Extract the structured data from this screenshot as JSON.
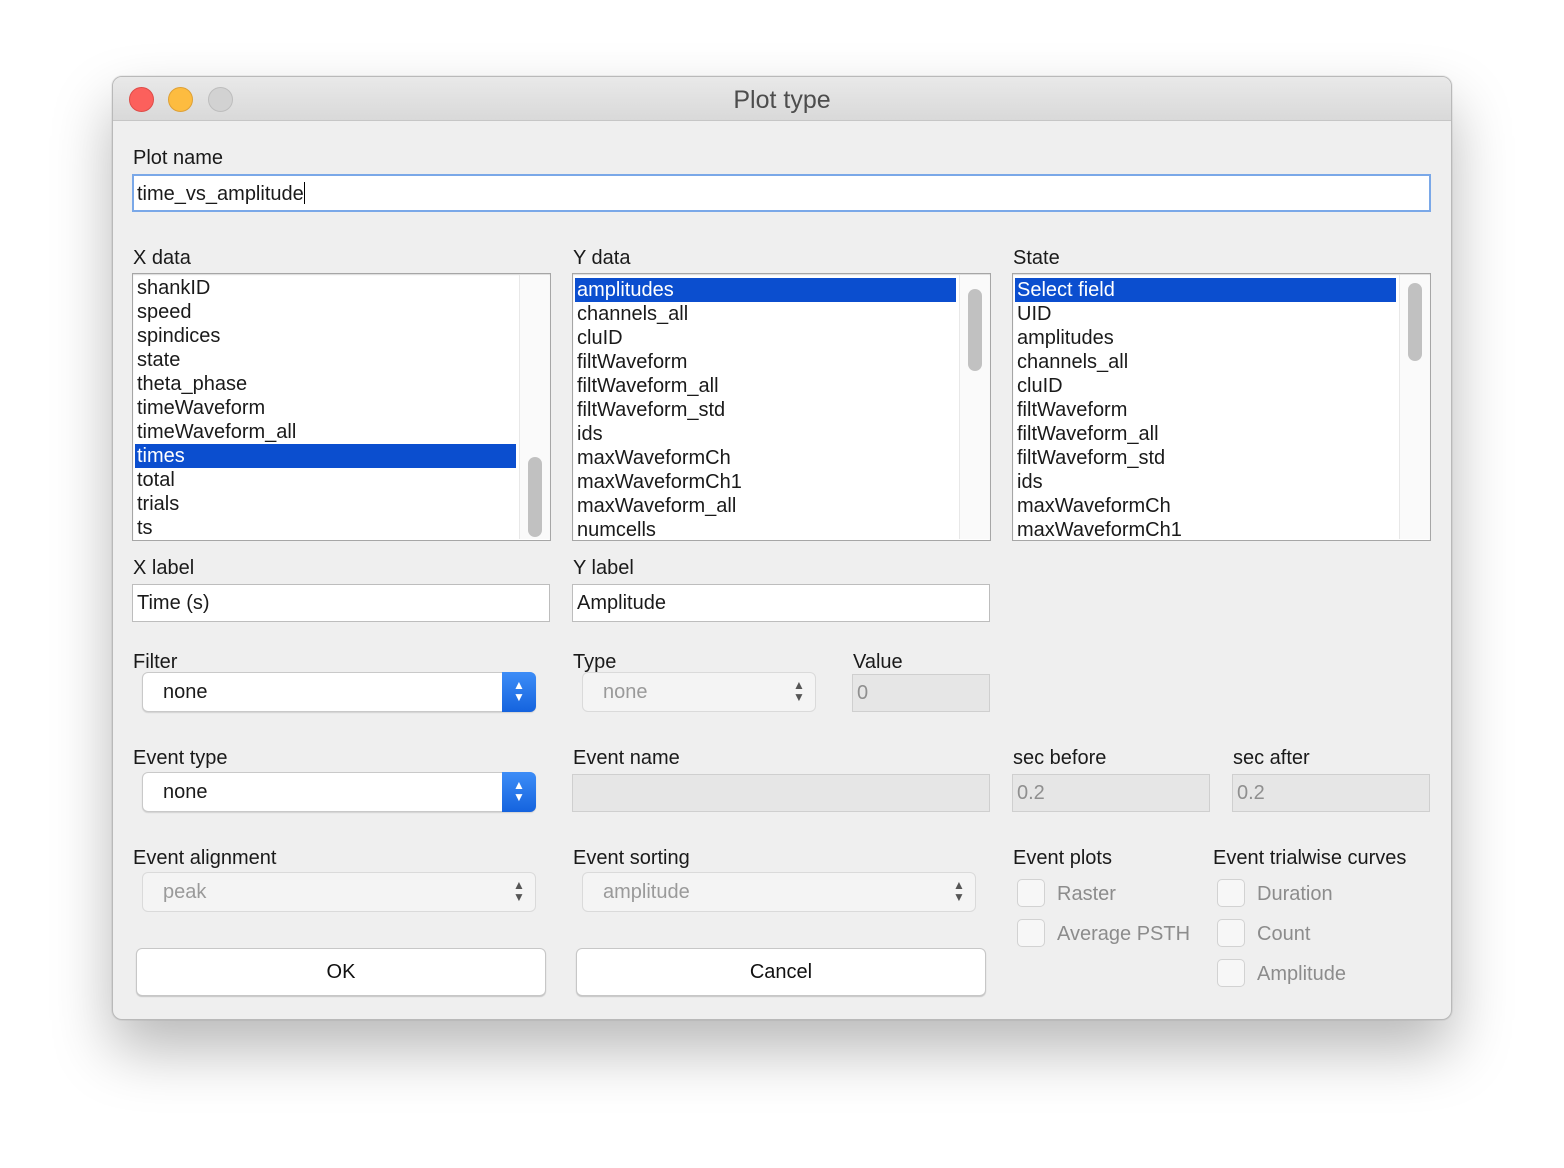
{
  "window": {
    "title": "Plot type"
  },
  "plot_name": {
    "label": "Plot name",
    "value": "time_vs_amplitude"
  },
  "x_data": {
    "label": "X data",
    "items": [
      "shankID",
      "speed",
      "spindices",
      "state",
      "theta_phase",
      "timeWaveform",
      "timeWaveform_all",
      "times",
      "total",
      "trials",
      "ts"
    ],
    "selected": "times"
  },
  "y_data": {
    "label": "Y data",
    "items": [
      "amplitudes",
      "channels_all",
      "cluID",
      "filtWaveform",
      "filtWaveform_all",
      "filtWaveform_std",
      "ids",
      "maxWaveformCh",
      "maxWaveformCh1",
      "maxWaveform_all",
      "numcells"
    ],
    "selected": "amplitudes"
  },
  "state": {
    "label": "State",
    "items": [
      "Select field",
      "UID",
      "amplitudes",
      "channels_all",
      "cluID",
      "filtWaveform",
      "filtWaveform_all",
      "filtWaveform_std",
      "ids",
      "maxWaveformCh",
      "maxWaveformCh1"
    ],
    "selected": "Select field"
  },
  "x_label": {
    "label": "X label",
    "value": "Time (s)"
  },
  "y_label": {
    "label": "Y label",
    "value": "Amplitude"
  },
  "filter": {
    "label": "Filter",
    "value": "none"
  },
  "type": {
    "label": "Type",
    "value": "none"
  },
  "value": {
    "label": "Value",
    "value": "0"
  },
  "event_type": {
    "label": "Event type",
    "value": "none"
  },
  "event_name": {
    "label": "Event name",
    "value": ""
  },
  "sec_before": {
    "label": "sec before",
    "value": "0.2"
  },
  "sec_after": {
    "label": "sec after",
    "value": "0.2"
  },
  "event_alignment": {
    "label": "Event alignment",
    "value": "peak"
  },
  "event_sorting": {
    "label": "Event sorting",
    "value": "amplitude"
  },
  "event_plots": {
    "label": "Event plots",
    "options": [
      "Raster",
      "Average PSTH"
    ]
  },
  "event_trialwise": {
    "label": "Event trialwise curves",
    "options": [
      "Duration",
      "Count",
      "Amplitude"
    ]
  },
  "buttons": {
    "ok": "OK",
    "cancel": "Cancel"
  },
  "colors": {
    "selection": "#0b4ecf",
    "popup_accent": "#1f74eb",
    "close": "#fc605c",
    "minimize": "#fdbc40"
  }
}
